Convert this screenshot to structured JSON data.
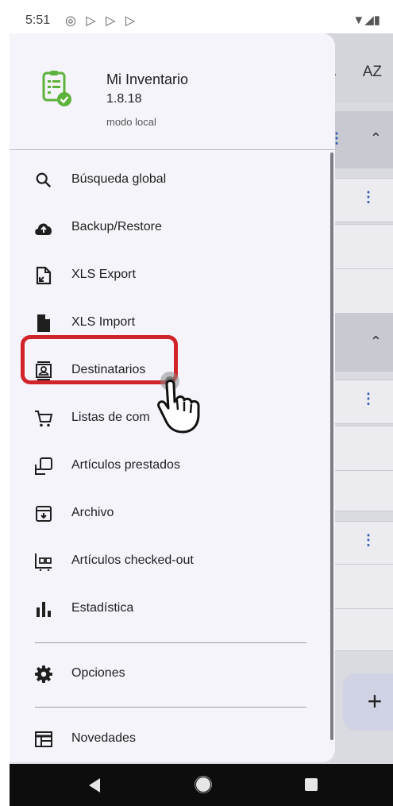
{
  "status_bar": {
    "time": "5:51",
    "left_icons": "◎ ▷ ▷ ▷",
    "right_icons": "▼◢▮"
  },
  "background": {
    "sort_label": "AZ",
    "fab_label": "+"
  },
  "drawer": {
    "app_name": "Mi Inventario",
    "version": "1.8.18",
    "mode": "modo local",
    "items": [
      {
        "label": "Búsqueda global",
        "icon": "search-icon"
      },
      {
        "label": "Backup/Restore",
        "icon": "cloud-upload-icon"
      },
      {
        "label": "XLS Export",
        "icon": "file-export-icon"
      },
      {
        "label": "XLS Import",
        "icon": "file-icon"
      },
      {
        "label": "Destinatarios",
        "icon": "contact-card-icon"
      },
      {
        "label": "Listas de com",
        "icon": "cart-icon"
      },
      {
        "label": "Artículos prestados",
        "icon": "lend-icon"
      },
      {
        "label": "Archivo",
        "icon": "archive-icon"
      },
      {
        "label": "Artículos checked-out",
        "icon": "checked-out-icon"
      },
      {
        "label": "Estadística",
        "icon": "bar-chart-icon"
      }
    ],
    "options_label": "Opciones",
    "news_label": "Novedades"
  },
  "colors": {
    "highlight": "#d0242a",
    "logo_green": "#5cb23a"
  }
}
